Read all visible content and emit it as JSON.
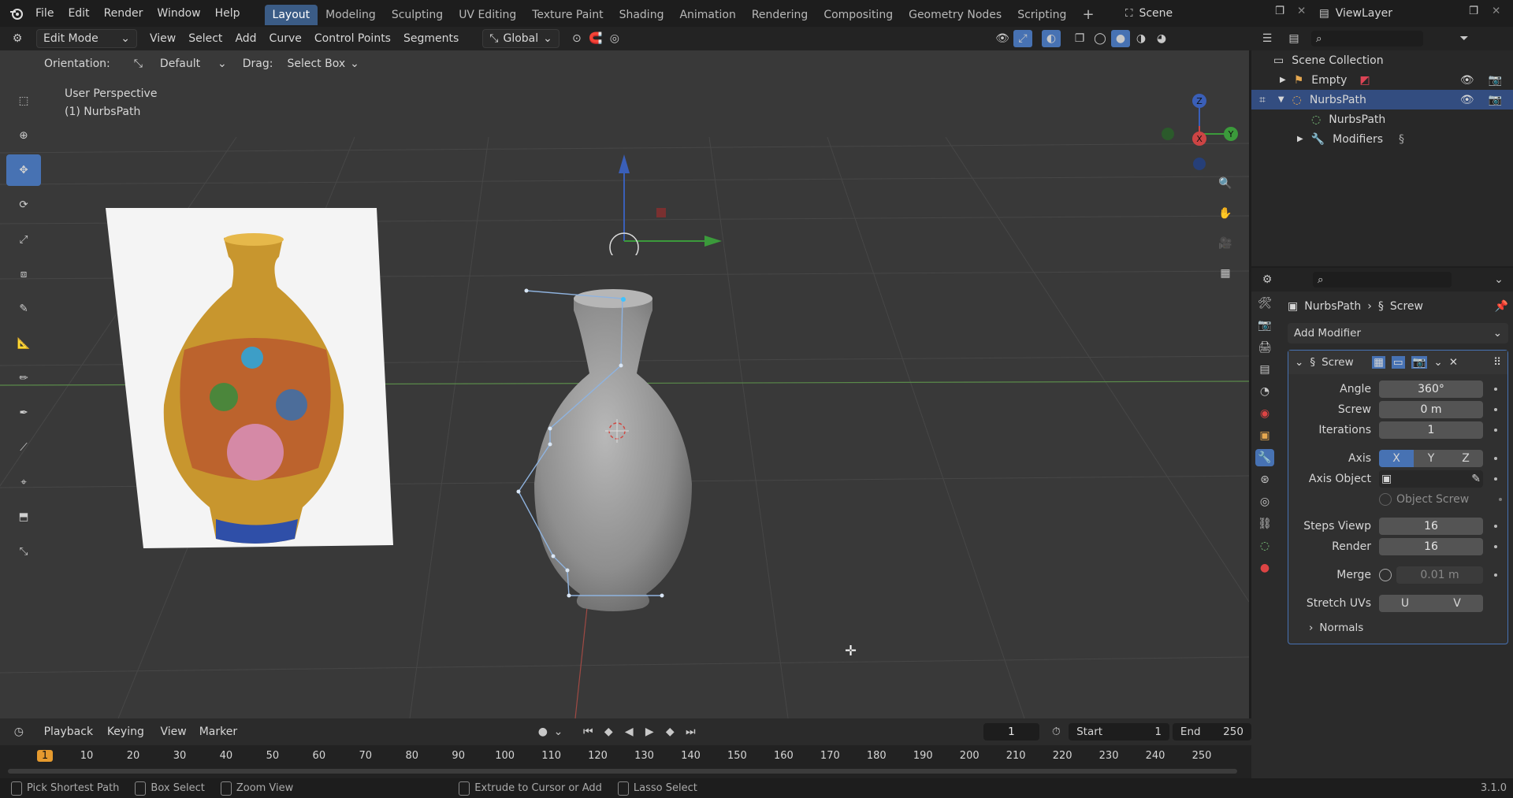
{
  "top_menu": [
    "File",
    "Edit",
    "Render",
    "Window",
    "Help"
  ],
  "workspaces": [
    "Layout",
    "Modeling",
    "Sculpting",
    "UV Editing",
    "Texture Paint",
    "Shading",
    "Animation",
    "Rendering",
    "Compositing",
    "Geometry Nodes",
    "Scripting"
  ],
  "active_workspace": "Layout",
  "scene_name": "Scene",
  "view_layer": "ViewLayer",
  "header": {
    "mode": "Edit Mode",
    "menus": [
      "View",
      "Select",
      "Add",
      "Curve",
      "Control Points",
      "Segments"
    ],
    "transform_orientation": "Global"
  },
  "tool_settings": {
    "orientation_label": "Orientation:",
    "orientation_value": "Default",
    "drag_label": "Drag:",
    "drag_value": "Select Box"
  },
  "viewport": {
    "perspective": "User Perspective",
    "object": "(1) NurbsPath"
  },
  "outliner": {
    "root": "Scene Collection",
    "items": [
      {
        "name": "Empty",
        "selected": false
      },
      {
        "name": "NurbsPath",
        "selected": true
      },
      {
        "name": "NurbsPath",
        "selected": false
      },
      {
        "name": "Modifiers",
        "selected": false
      }
    ]
  },
  "properties": {
    "breadcrumb_object": "NurbsPath",
    "breadcrumb_modifier": "Screw",
    "add_modifier": "Add Modifier",
    "modifier_name": "Screw",
    "angle_label": "Angle",
    "angle": "360°",
    "screw_label": "Screw",
    "screw": "0 m",
    "iterations_label": "Iterations",
    "iterations": "1",
    "axis_label": "Axis",
    "axis_options": [
      "X",
      "Y",
      "Z"
    ],
    "axis_selected": "X",
    "axis_object_label": "Axis Object",
    "object_screw": "Object Screw",
    "steps_viewport_label": "Steps Viewp",
    "steps_viewport": "16",
    "render_label": "Render",
    "render": "16",
    "merge_label": "Merge",
    "merge": "0.01 m",
    "stretch_uvs_label": "Stretch UVs",
    "stretch_u": "U",
    "stretch_v": "V",
    "normals": "Normals"
  },
  "timeline": {
    "menus": [
      "Playback",
      "Keying",
      "View",
      "Marker"
    ],
    "current_frame": "1",
    "start_label": "Start",
    "start": "1",
    "end_label": "End",
    "end": "250",
    "ticks": [
      "1",
      "10",
      "20",
      "30",
      "40",
      "50",
      "60",
      "70",
      "80",
      "90",
      "100",
      "110",
      "120",
      "130",
      "140",
      "150",
      "160",
      "170",
      "180",
      "190",
      "200",
      "210",
      "220",
      "230",
      "240",
      "250"
    ]
  },
  "statusbar": {
    "items": [
      "Pick Shortest Path",
      "Box Select",
      "Zoom View",
      "Extrude to Cursor or Add",
      "Lasso Select"
    ],
    "version": "3.1.0"
  },
  "colors": {
    "accent": "#4772b3",
    "selected_row": "#334d80",
    "active_tab": "#3b5c86"
  }
}
